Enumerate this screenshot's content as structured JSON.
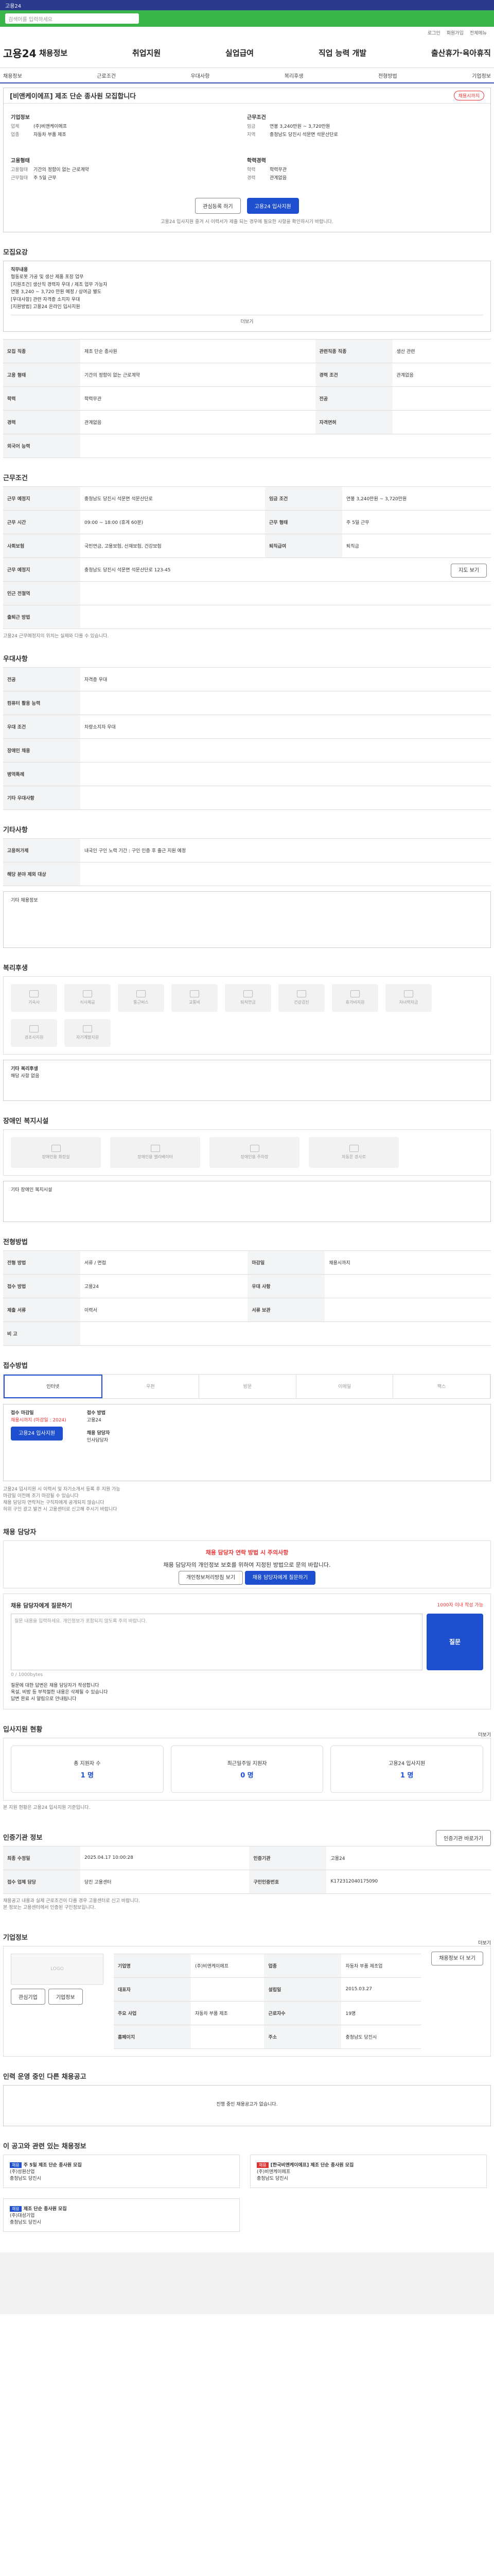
{
  "header": {
    "top_text": "고용24",
    "util": [
      "로그인",
      "회원가입",
      "전체메뉴"
    ],
    "logo": "고용24",
    "search_placeholder": "검색어를 입력하세요",
    "menu": [
      "채용정보",
      "취업지원",
      "실업급여",
      "직업 능력 개발",
      "출산휴가·육아휴직"
    ],
    "subnav": [
      "채용정보",
      "근로조건",
      "우대사항",
      "복리후생",
      "전형방법",
      "기업정보"
    ]
  },
  "title": {
    "text": "[비앤케이에프] 제조 단순 종사원 모집합니다",
    "badge": "채용시까지",
    "company_label": "기업정보",
    "company": [
      [
        "업체",
        "(주)비앤케이에프"
      ],
      [
        "업종",
        "자동차 부품 제조"
      ]
    ],
    "cond_label": "근무조건",
    "cond": [
      [
        "임금",
        "연봉 3,240만원 ~ 3,720만원"
      ],
      [
        "지역",
        "충청남도 당진시 석문면 석문산단로"
      ]
    ],
    "req_label": "고용형태",
    "req": [
      [
        "고용형태",
        "기간의 정함이 없는 근로계약"
      ],
      [
        "근무형태",
        "주 5일 근무"
      ]
    ],
    "edu_label": "학력경력",
    "edu": [
      [
        "학력",
        "학력무관"
      ],
      [
        "경력",
        "관계없음"
      ]
    ],
    "btn_scrap": "관심등록 하기",
    "btn_apply": "고용24 입사지원",
    "note": "고용24 입사지원 즐겨 시 이력서가 제출 되는 경우에 필요한 사항을 확인하시기 바랍니다."
  },
  "recruit": {
    "heading": "모집요강",
    "duty_title": "직무내용",
    "duty": [
      "협동로봇 가공 및 생산 제품 포장 업무",
      "[지원조건] 생산직 경력자 우대 / 제조 업무 가능자",
      "연봉 3,240 ~ 3,720 만원 예정 / 상여금 별도",
      "[우대사항] 관련 자격증 소지자 우대",
      "[지원방법] 고용24 온라인 입사지원"
    ],
    "more": "더보기",
    "rows": [
      [
        "모집 직종",
        "제조 단순 종사원",
        "관련직종 직종",
        "생산 관련"
      ],
      [
        "고용 형태",
        "기간의 정함이 없는 근로계약",
        "경력 조건",
        "관계없음"
      ],
      [
        "학력",
        "학력무관",
        "전공",
        ""
      ],
      [
        "경력",
        "관계없음",
        "자격면허",
        ""
      ],
      [
        "외국어 능력",
        ""
      ]
    ]
  },
  "work": {
    "heading": "근무조건",
    "rows": [
      [
        "근무 예정지",
        "충청남도 당진시 석문면 석문산단로",
        "임금 조건",
        "연봉 3,240만원 ~ 3,720만원"
      ],
      [
        "근무 시간",
        "09:00 ~ 18:00 (휴게 60분)",
        "근무 형태",
        "주 5일 근무"
      ],
      [
        "사회보험",
        "국민연금, 고용보험, 산재보험, 건강보험",
        "퇴직급여",
        "퇴직금"
      ]
    ],
    "extra": [
      [
        "근무 예정지",
        "충청남도 당진시 석문면 석문산단로 123-45"
      ],
      [
        "인근 전철역",
        ""
      ],
      [
        "출퇴근 방법",
        ""
      ]
    ],
    "more": "지도 보기",
    "foot": "고용24 근무예정지의 위치는 실제와 다를 수 있습니다."
  },
  "pref": {
    "heading": "우대사항",
    "rows": [
      [
        "전공",
        "자격증 우대"
      ],
      [
        "컴퓨터 활용 능력",
        ""
      ],
      [
        "우대 조건",
        "차량소지자 우대"
      ],
      [
        "장애인 채용",
        ""
      ],
      [
        "병역특례",
        ""
      ],
      [
        "기타 우대사항",
        ""
      ]
    ]
  },
  "other": {
    "heading": "기타사항",
    "rows": [
      [
        "고용허가제",
        "내국인 구인 노력 기간 : 구인 인증 후 출근 지원 예정"
      ],
      [
        "해당 분야 제외 대상",
        ""
      ]
    ],
    "extra_title": "기타 채용정보"
  },
  "welfare": {
    "heading": "복리후생",
    "items": [
      "기숙사",
      "식사제공",
      "통근버스",
      "교통비",
      "퇴직연금",
      "건강검진",
      "휴가비지원",
      "자녀학자금",
      "경조사지원",
      "자기계발지원"
    ],
    "other_title": "기타 복리후생",
    "other": "해당 사항 없음"
  },
  "disabled": {
    "heading": "장애인 복지시설",
    "items": [
      "장애인용 화장실",
      "장애인용 엘리베이터",
      "장애인용 주차장",
      "자동문 경사로"
    ],
    "other_title": "기타 장애인 복지시설"
  },
  "method": {
    "heading": "전형방법",
    "rows": [
      [
        "전형 방법",
        "서류 / 면접",
        "마감일",
        "채용시까지"
      ],
      [
        "접수 방법",
        "고용24",
        "우대 사항",
        ""
      ],
      [
        "제출 서류",
        "이력서",
        "서류 보관",
        ""
      ],
      [
        "비 고",
        "",
        "",
        ""
      ]
    ]
  },
  "apply": {
    "heading": "접수방법",
    "tabs": [
      "인터넷",
      "우편",
      "방문",
      "이메일",
      "팩스"
    ],
    "left_label": "접수 마감일",
    "left_val": "채용시까지 (마감일 : 2024)",
    "right_label": "접수 방법",
    "right_val": "고용24",
    "cta": "고용24 입사지원",
    "contact_label": "채용 담당자",
    "contact": "인사담당자",
    "notes": [
      "고용24 입사지원 시 이력서 및 자기소개서 등록 후 지원 가능",
      "마감일 이전에 조기 마감될 수 있습니다",
      "채용 담당자 연락처는 구직자에게 공개되지 않습니다",
      "허위 구인 광고 발견 시 고용센터로 신고해 주시기 바랍니다"
    ]
  },
  "inquiry": {
    "heading": "채용 담당자",
    "warn": "채용 담당자 연락 방법 시 주의사항",
    "warn_text": "채용 담당자의 개인정보 보호를 위하여 지정된 방법으로 문의 바랍니다.",
    "b1": "개인정보처리방침 보기",
    "b2": "채용 담당자에게 질문하기",
    "ask_title": "채용 담당자에게 질문하기",
    "ask_note": "1000자 이내 작성 가능",
    "placeholder": "질문 내용을 입력하세요. 개인정보가 포함되지 않도록 주의 바랍니다.",
    "count": "0 / 1000bytes",
    "ask_btn": "질문",
    "tips": [
      "질문에 대한 답변은 채용 담당자가 작성합니다",
      "욕설, 비방 등 부적절한 내용은 삭제될 수 있습니다",
      "답변 완료 시 알림으로 안내됩니다"
    ]
  },
  "status": {
    "heading": "입사지원 현황",
    "more": "더보기",
    "items": [
      [
        "총 지원자 수",
        "1 명"
      ],
      [
        "최근일주일 지원자",
        "0 명"
      ],
      [
        "고용24 입사지원",
        "1 명"
      ]
    ],
    "note": "본 지원 현황은 고용24 입사지원 기준입니다."
  },
  "mgmt": {
    "heading": "인증기관 정보",
    "btn": "인증기관 바로가기",
    "rows": [
      [
        "최종 수정일",
        "2025.04.17 10:00:28",
        "인증기관",
        "고용24"
      ],
      [
        "접수 업체 담당",
        "당진 고용센터",
        "구인인증번호",
        "K172312040175090"
      ]
    ],
    "notes": [
      "채용공고 내용과 실제 근로조건이 다를 경우 고용센터로 신고 바랍니다.",
      "본 정보는 고용센터에서 인증된 구인정보입니다."
    ]
  },
  "company": {
    "heading": "기업정보",
    "more": "더보기",
    "logo": "LOGO",
    "btns": [
      "관심기업",
      "기업정보"
    ],
    "rows": [
      [
        "기업명",
        "(주)비앤케이에프",
        "업종",
        "자동차 부품 제조업"
      ],
      [
        "대표자",
        "",
        "설립일",
        "2015.03.27"
      ],
      [
        "주요 사업",
        "자동차 부품 제조",
        "근로자수",
        "19명"
      ],
      [
        "홈페이지",
        "",
        "주소",
        "충청남도 당진시"
      ]
    ],
    "map_btn": "채용정보 더 보기"
  },
  "same": {
    "heading": "인력 운영 중인 다른 채용공고",
    "empty": "진행 중인 채용공고가 없습니다."
  },
  "rel": {
    "heading": "이 공고와 관련 있는 채용정보",
    "cards": [
      {
        "tag": "채용",
        "title": "주 5일 제조 단순 종사원 모집",
        "sub": "(주)성원산업",
        "loc": "충청남도 당진시"
      },
      {
        "tag": "채용",
        "title": "[한국비앤케이에프] 제조 단순 종사원 모집",
        "sub": "(주)비앤케이에프",
        "loc": "충청남도 당진시"
      },
      {
        "tag": "채용",
        "title": "제조 단순 종사원 모집",
        "sub": "(주)대성기업",
        "loc": "충청남도 당진시"
      }
    ]
  }
}
